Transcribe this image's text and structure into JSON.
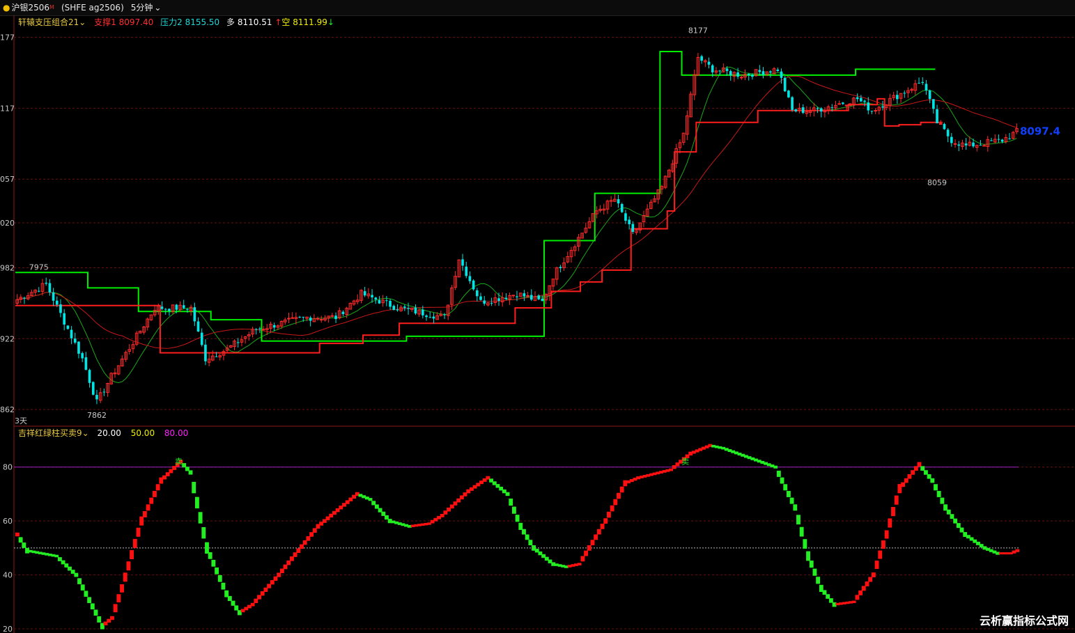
{
  "header": {
    "symbol": "沪银2506",
    "flag": "M",
    "code": "(SHFE ag2506)",
    "period": "5分钟",
    "dropdown_icon": "chevron-down-icon"
  },
  "main_panel": {
    "indicator_name": "轩辕支压组合21",
    "support_label": "支撑1",
    "support_value": "8097.40",
    "resist_label": "压力2",
    "resist_value": "8155.50",
    "long_label": "多",
    "long_value": "8110.51",
    "short_label": "空",
    "short_value": "8111.99",
    "y_ticks": [
      "177",
      "117",
      "057",
      "020",
      "982",
      "922",
      "862"
    ],
    "high_label": "8177",
    "low_label": "7862",
    "first_high_label": "7975",
    "late_low_label": "8059",
    "last_price": "8097.4",
    "range_label": "3天"
  },
  "sub_panel": {
    "indicator_name": "吉祥红绿柱买卖9",
    "level_low": "20.00",
    "level_mid": "50.00",
    "level_high": "80.00",
    "y_ticks": [
      "80",
      "60",
      "40",
      "20"
    ],
    "signal_label": "卖"
  },
  "watermark": "云析赢指标公式网",
  "colors": {
    "up": "#ff2a2a",
    "down": "#00e5e5",
    "osc_up": "#ff1010",
    "osc_down": "#22ee22",
    "resist": "#00ee00",
    "support": "#ff1e1e",
    "level80": "#a020c0",
    "last_price": "#1040ff"
  },
  "chart_data": [
    {
      "type": "candlestick",
      "title": "沪银2506 5分钟",
      "ylim": [
        7855,
        8185
      ],
      "keypoints": [
        [
          0,
          7955
        ],
        [
          8,
          7968
        ],
        [
          18,
          7905
        ],
        [
          22,
          7868
        ],
        [
          26,
          7890
        ],
        [
          38,
          7948
        ],
        [
          48,
          7948
        ],
        [
          52,
          7905
        ],
        [
          58,
          7913
        ],
        [
          66,
          7930
        ],
        [
          80,
          7940
        ],
        [
          88,
          7940
        ],
        [
          95,
          7960
        ],
        [
          105,
          7948
        ],
        [
          118,
          7940
        ],
        [
          122,
          7990
        ],
        [
          128,
          7953
        ],
        [
          138,
          7960
        ],
        [
          145,
          7953
        ],
        [
          148,
          7975
        ],
        [
          160,
          8030
        ],
        [
          165,
          8040
        ],
        [
          170,
          8010
        ],
        [
          178,
          8050
        ],
        [
          184,
          8095
        ],
        [
          188,
          8160
        ],
        [
          192,
          8150
        ],
        [
          200,
          8145
        ],
        [
          210,
          8150
        ],
        [
          214,
          8115
        ],
        [
          220,
          8115
        ],
        [
          232,
          8125
        ],
        [
          236,
          8115
        ],
        [
          250,
          8140
        ],
        [
          254,
          8105
        ],
        [
          258,
          8090
        ],
        [
          262,
          8085
        ],
        [
          272,
          8090
        ],
        [
          276,
          8097
        ]
      ],
      "support_steps": [
        [
          0,
          7950
        ],
        [
          30,
          7950
        ],
        [
          40,
          7910
        ],
        [
          79,
          7910
        ],
        [
          84,
          7918
        ],
        [
          96,
          7925
        ],
        [
          101,
          7925
        ],
        [
          106,
          7935
        ],
        [
          124,
          7935
        ],
        [
          138,
          7948
        ],
        [
          148,
          7962
        ],
        [
          156,
          7970
        ],
        [
          162,
          7980
        ],
        [
          170,
          8015
        ],
        [
          180,
          8030
        ],
        [
          182,
          8080
        ],
        [
          188,
          8105
        ],
        [
          199,
          8105
        ],
        [
          205,
          8115
        ],
        [
          228,
          8115
        ],
        [
          230,
          8120
        ],
        [
          238,
          8125
        ],
        [
          240,
          8102
        ],
        [
          244,
          8103
        ],
        [
          250,
          8105
        ]
      ],
      "resist_steps": [
        [
          0,
          7978
        ],
        [
          12,
          7978
        ],
        [
          20,
          7965
        ],
        [
          34,
          7945
        ],
        [
          50,
          7945
        ],
        [
          54,
          7938
        ],
        [
          64,
          7938
        ],
        [
          68,
          7920
        ],
        [
          104,
          7920
        ],
        [
          108,
          7924
        ],
        [
          142,
          7924
        ],
        [
          146,
          8005
        ],
        [
          156,
          8005
        ],
        [
          160,
          8045
        ],
        [
          176,
          8045
        ],
        [
          178,
          8165
        ],
        [
          184,
          8145
        ],
        [
          230,
          8145
        ],
        [
          232,
          8150
        ],
        [
          248,
          8150
        ]
      ],
      "high": 8177,
      "low": 7862,
      "last": 8097.4
    },
    {
      "type": "bar",
      "title": "吉祥红绿柱买卖9",
      "ylim": [
        20,
        90
      ],
      "levels": [
        20,
        50,
        80
      ],
      "keypoints": [
        [
          0,
          55
        ],
        [
          3,
          49
        ],
        [
          12,
          47
        ],
        [
          18,
          40
        ],
        [
          24,
          26
        ],
        [
          26,
          21
        ],
        [
          29,
          24
        ],
        [
          32,
          35
        ],
        [
          38,
          60
        ],
        [
          44,
          75
        ],
        [
          50,
          82
        ],
        [
          53,
          78
        ],
        [
          58,
          50
        ],
        [
          64,
          33
        ],
        [
          68,
          26
        ],
        [
          72,
          29
        ],
        [
          80,
          40
        ],
        [
          92,
          58
        ],
        [
          100,
          66
        ],
        [
          104,
          70
        ],
        [
          108,
          68
        ],
        [
          114,
          60
        ],
        [
          120,
          58
        ],
        [
          126,
          59
        ],
        [
          130,
          62
        ],
        [
          138,
          71
        ],
        [
          144,
          76
        ],
        [
          150,
          70
        ],
        [
          154,
          58
        ],
        [
          158,
          50
        ],
        [
          164,
          44
        ],
        [
          168,
          43
        ],
        [
          172,
          44
        ],
        [
          180,
          60
        ],
        [
          186,
          74
        ],
        [
          190,
          76
        ],
        [
          200,
          79
        ],
        [
          206,
          85
        ],
        [
          212,
          88
        ],
        [
          216,
          87
        ],
        [
          232,
          80
        ],
        [
          238,
          65
        ],
        [
          242,
          47
        ],
        [
          246,
          35
        ],
        [
          250,
          29
        ],
        [
          256,
          30
        ],
        [
          262,
          40
        ],
        [
          266,
          55
        ],
        [
          270,
          72
        ],
        [
          276,
          81
        ],
        [
          280,
          75
        ],
        [
          284,
          65
        ],
        [
          290,
          55
        ],
        [
          296,
          50
        ],
        [
          300,
          48
        ],
        [
          304,
          48
        ],
        [
          306,
          49
        ]
      ],
      "signals": [
        [
          50,
          "卖"
        ],
        [
          205,
          "卖"
        ]
      ]
    }
  ]
}
